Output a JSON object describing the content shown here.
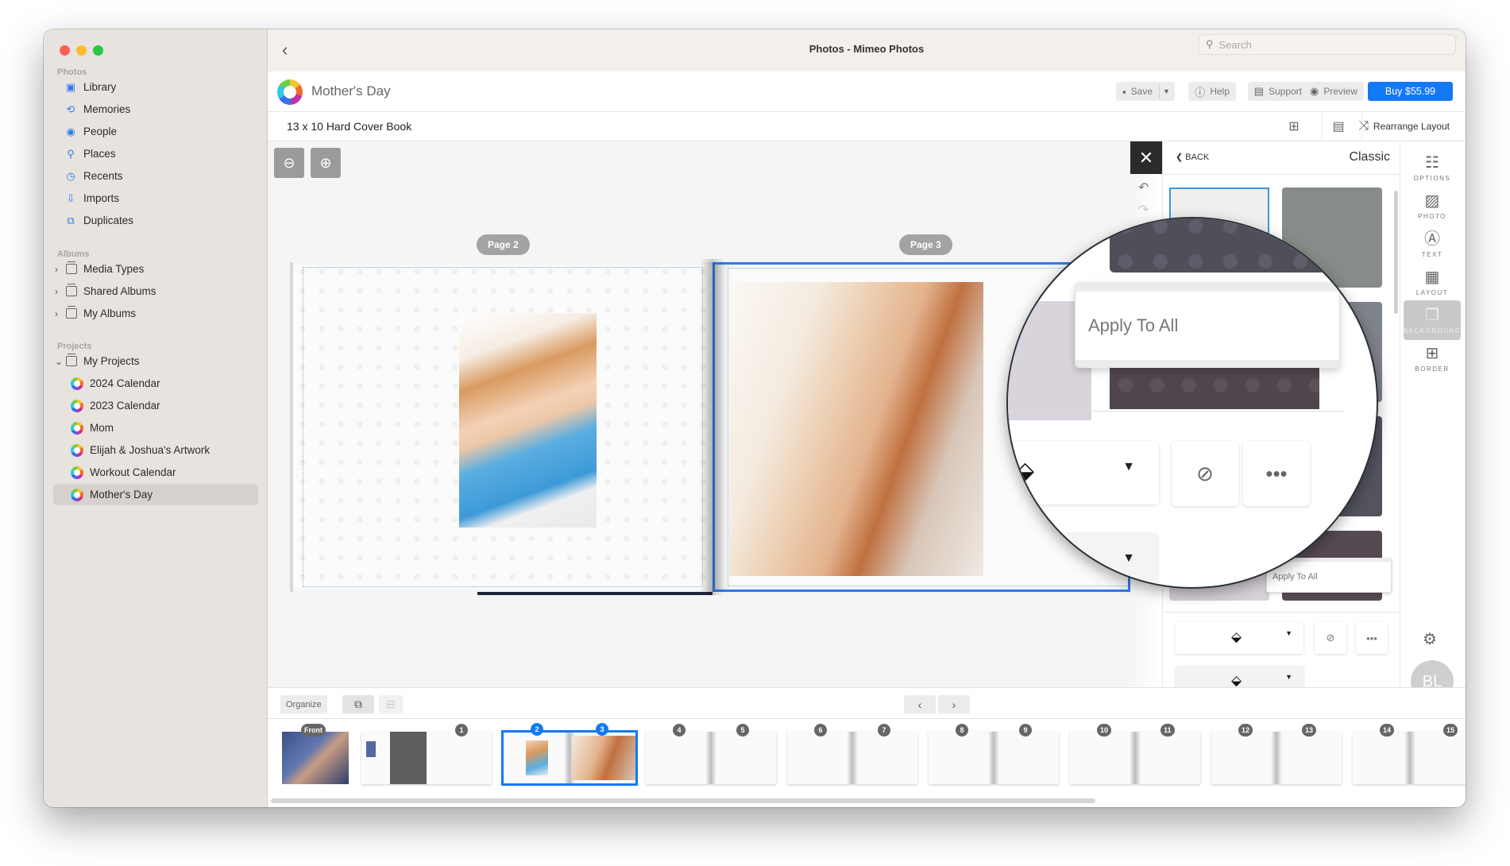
{
  "window": {
    "title": "Photos - Mimeo Photos",
    "search_placeholder": "Search",
    "traffic_colors": [
      "#fe5f57",
      "#febc2e",
      "#28c840"
    ]
  },
  "sidebar": {
    "sections": [
      {
        "label": "Photos",
        "items": [
          {
            "label": "Library",
            "icon": "library-icon"
          },
          {
            "label": "Memories",
            "icon": "memories-icon"
          },
          {
            "label": "People",
            "icon": "people-icon"
          },
          {
            "label": "Places",
            "icon": "places-icon"
          },
          {
            "label": "Recents",
            "icon": "recents-icon"
          },
          {
            "label": "Imports",
            "icon": "imports-icon"
          },
          {
            "label": "Duplicates",
            "icon": "duplicates-icon"
          }
        ]
      },
      {
        "label": "Albums",
        "items": [
          {
            "label": "Media Types",
            "icon": "folder-icon",
            "expandable": true
          },
          {
            "label": "Shared Albums",
            "icon": "shared-folder-icon",
            "expandable": true
          },
          {
            "label": "My Albums",
            "icon": "folder-icon",
            "expandable": true
          }
        ]
      },
      {
        "label": "Projects",
        "items": [
          {
            "label": "My Projects",
            "icon": "folder-icon",
            "expanded": true
          }
        ]
      }
    ],
    "projects": [
      {
        "label": "2024 Calendar"
      },
      {
        "label": "2023 Calendar"
      },
      {
        "label": "Mom"
      },
      {
        "label": "Elijah & Joshua's Artwork"
      },
      {
        "label": "Workout Calendar"
      },
      {
        "label": "Mother's Day",
        "selected": true
      }
    ]
  },
  "header": {
    "project_name": "Mother's Day",
    "save": "Save",
    "help": "Help",
    "support": "Support",
    "preview": "Preview",
    "buy": "Buy $55.99",
    "accent": "#1479f5"
  },
  "subtoolbar": {
    "book_title": "13 x 10 Hard Cover Book",
    "rearrange": "Rearrange Layout"
  },
  "canvas": {
    "page_left_label": "Page 2",
    "page_right_label": "Page 3"
  },
  "magnifier": {
    "apply_label": "Apply To All"
  },
  "right_panel": {
    "back": "BACK",
    "title": "Classic",
    "apply_small": "Apply To All",
    "swatches": [
      {
        "color": "#efefef",
        "selected": true
      },
      {
        "color": "#888c88"
      },
      {
        "color": "#7f838c"
      },
      {
        "color": "#54545f"
      },
      {
        "color": "#d8d2d8"
      },
      {
        "color": "#564a52"
      }
    ]
  },
  "rail": {
    "items": [
      {
        "label": "OPTIONS",
        "icon": "options-icon"
      },
      {
        "label": "PHOTO",
        "icon": "photo-icon"
      },
      {
        "label": "TEXT",
        "icon": "text-icon"
      },
      {
        "label": "LAYOUT",
        "icon": "layout-icon"
      },
      {
        "label": "BACKGROUND",
        "icon": "background-icon",
        "active": true
      },
      {
        "label": "BORDER",
        "icon": "border-icon"
      }
    ],
    "avatar": "BL"
  },
  "bottombar": {
    "organize": "Organize"
  },
  "thumbnails": {
    "front": "Front",
    "spreads": [
      {
        "left": null,
        "right": "1"
      },
      {
        "left": "2",
        "right": "3",
        "selected": true
      },
      {
        "left": "4",
        "right": "5"
      },
      {
        "left": "6",
        "right": "7"
      },
      {
        "left": "8",
        "right": "9"
      },
      {
        "left": "10",
        "right": "11"
      },
      {
        "left": "12",
        "right": "13"
      },
      {
        "left": "14",
        "right": "15"
      }
    ]
  }
}
